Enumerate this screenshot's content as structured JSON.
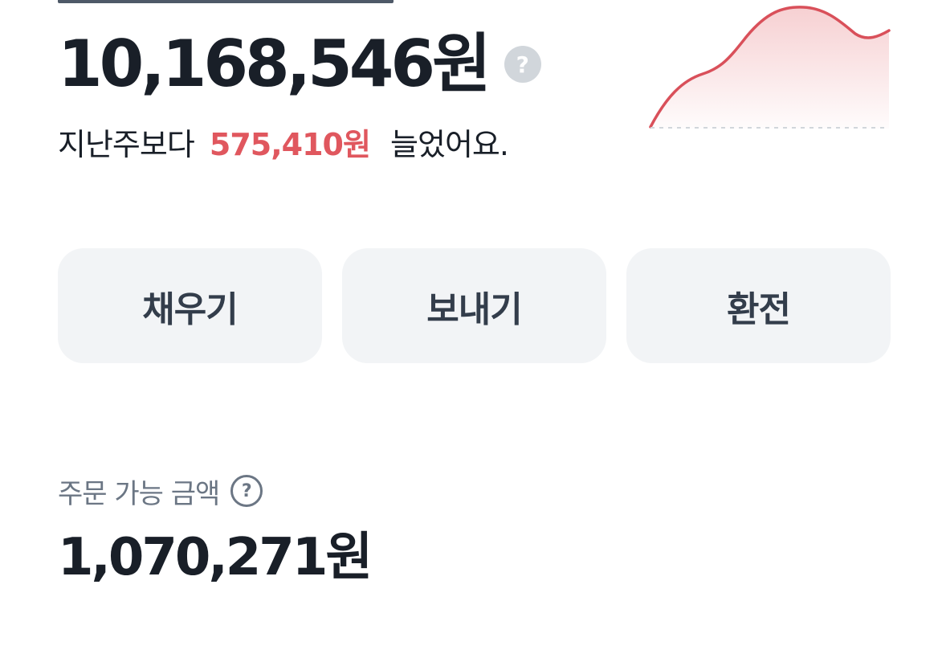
{
  "balance": {
    "amount": "10,168,546원",
    "help_icon": "question-icon",
    "help_symbol": "?"
  },
  "weekly_change": {
    "prefix": "지난주보다",
    "amount": "575,410원",
    "suffix": "늘었어요.",
    "color": "#e0575e"
  },
  "sparkline": {
    "icon": "trend-sparkline",
    "color": "#d9505a",
    "trend": "up"
  },
  "actions": [
    {
      "label": "채우기"
    },
    {
      "label": "보내기"
    },
    {
      "label": "환전"
    }
  ],
  "orderable": {
    "label": "주문 가능 금액",
    "help_symbol": "?",
    "amount": "1,070,271원"
  },
  "colors": {
    "accent_red": "#e0575e",
    "button_bg": "#f2f4f6",
    "primary_text": "#191f28",
    "secondary_text": "#6b7684"
  }
}
